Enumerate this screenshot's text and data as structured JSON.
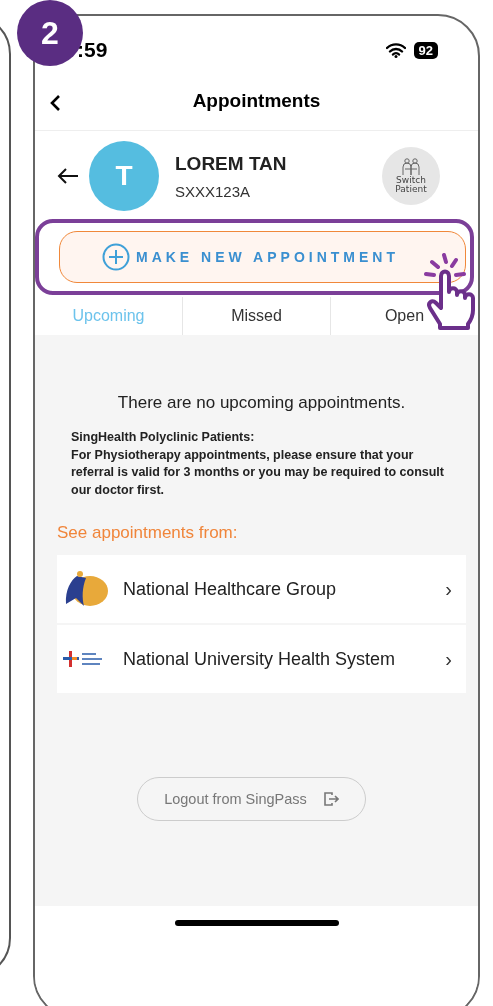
{
  "step_badge": "2",
  "status_bar": {
    "time": ":59",
    "battery": "92"
  },
  "nav": {
    "title": "Appointments"
  },
  "patient": {
    "initial": "T",
    "name": "LOREM TAN",
    "id": "SXXX123A",
    "switch_label": "Switch Patient"
  },
  "make_appointment": {
    "label": "MAKE NEW APPOINTMENT",
    "highlighted": true
  },
  "tabs": [
    {
      "label": "Upcoming",
      "selected": true
    },
    {
      "label": "Missed",
      "selected": false
    },
    {
      "label": "Open",
      "selected": false
    }
  ],
  "empty_message": "There are no upcoming appointments.",
  "notice": {
    "title": "SingHealth Polyclinic Patients:",
    "body": "For Physiotherapy appointments, please ensure that your referral is valid for 3 months or you may be required to consult our doctor first."
  },
  "providers_heading": "See appointments from:",
  "providers": [
    {
      "kind": "nhg",
      "name": "National Healthcare Group",
      "chevron": "›"
    },
    {
      "kind": "nuhs",
      "name": "National University Health System",
      "chevron": "›"
    }
  ],
  "logout": {
    "label": "Logout from SingPass"
  }
}
